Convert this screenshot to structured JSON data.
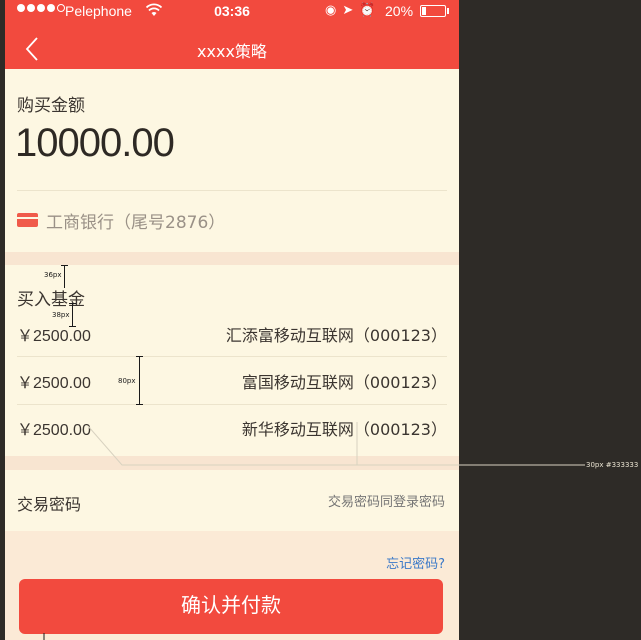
{
  "status_bar": {
    "carrier": "Pelephone",
    "time": "03:36",
    "battery": "20%",
    "battery_level": 0.2
  },
  "nav": {
    "title": "xxxx策略",
    "back_icon": "chevron-left-icon"
  },
  "purchase": {
    "label": "购买金额",
    "amount": "10000.00",
    "bank_icon": "bank-card-icon",
    "bank": "工商银行（尾号2876）"
  },
  "funds": {
    "label": "买入基金",
    "items": [
      {
        "amount": "￥2500.00",
        "name": "汇添富移动互联网（000123）"
      },
      {
        "amount": "￥2500.00",
        "name": "富国移动互联网（000123）"
      },
      {
        "amount": "￥2500.00",
        "name": "新华移动互联网（000123）"
      }
    ]
  },
  "password": {
    "label": "交易密码",
    "placeholder": "交易密码同登录密码"
  },
  "forgot_label": "忘记密码?",
  "confirm_label": "确认并付款",
  "annotations": {
    "a36": "36px",
    "a38": "38px",
    "a80": "80px",
    "callout": "30px #333333"
  },
  "colors": {
    "accent": "#f24a3e",
    "background": "#fdf7e2",
    "link": "#3b79c8"
  }
}
